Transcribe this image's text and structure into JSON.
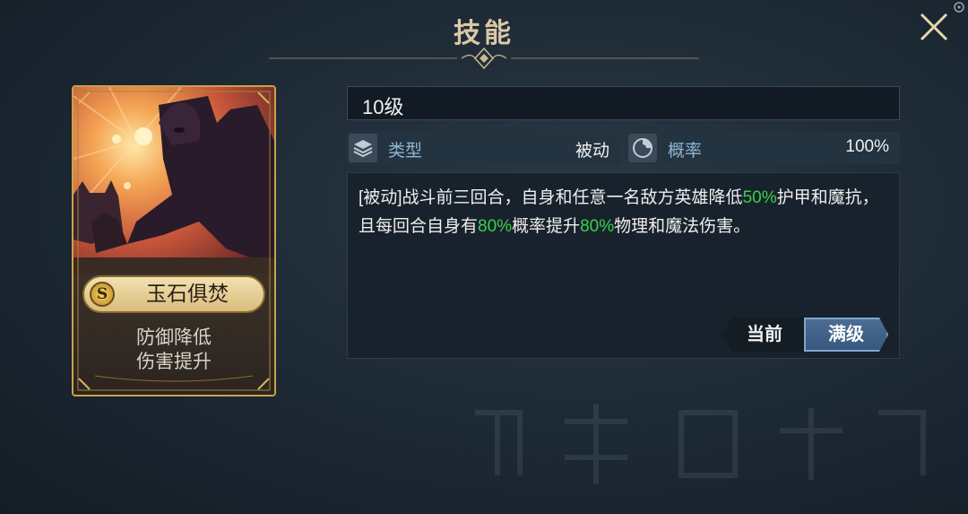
{
  "header": {
    "title": "技能"
  },
  "card": {
    "rank": "S",
    "name": "玉石俱焚",
    "desc_line1": "防御降低",
    "desc_line2": "伤害提升"
  },
  "skill": {
    "level": "10级",
    "type_label": "类型",
    "type_value": "被动",
    "chance_label": "概率",
    "chance_value": "100%",
    "description": {
      "p1": "[被动]战斗前三回合，自身和任意一名敌方英雄降低",
      "h1": "50%",
      "p2": "护甲和魔抗，且每回合自身有",
      "h2": "80%",
      "p3": "概率提升",
      "h3": "80%",
      "p4": "物理和魔法伤害。"
    }
  },
  "toggle": {
    "current_label": "当前",
    "max_label": "满级",
    "selected": "max"
  },
  "colors": {
    "accent_gold": "#d9c9a4",
    "highlight_green": "#39d24a",
    "button_blue": "#4d6f95"
  },
  "icons": [
    "close-icon",
    "layers-icon",
    "chance-dial-icon",
    "corner-icon",
    "title-ornament-icon"
  ]
}
